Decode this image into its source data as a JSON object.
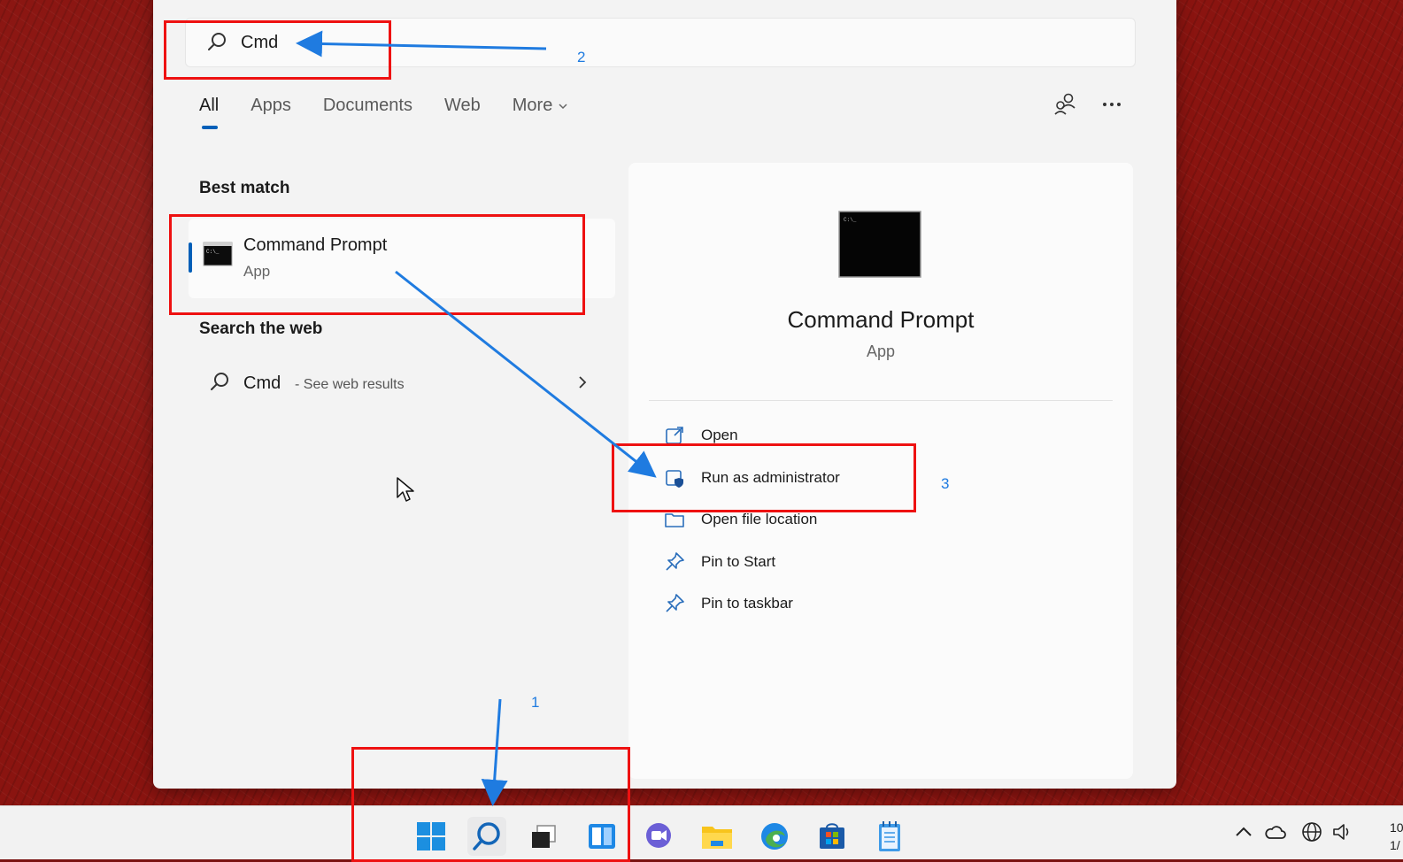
{
  "search": {
    "value": "Cmd",
    "placeholder": ""
  },
  "tabs": [
    {
      "label": "All",
      "active": true
    },
    {
      "label": "Apps"
    },
    {
      "label": "Documents"
    },
    {
      "label": "Web"
    },
    {
      "label": "More"
    }
  ],
  "best_match": {
    "heading": "Best match",
    "title": "Command Prompt",
    "subtitle": "App"
  },
  "web": {
    "heading": "Search the web",
    "query": "Cmd",
    "suffix": "- See web results"
  },
  "details": {
    "title": "Command Prompt",
    "subtitle": "App",
    "actions": [
      {
        "label": "Open",
        "icon": "open-external-icon"
      },
      {
        "label": "Run as administrator",
        "icon": "shield-window-icon"
      },
      {
        "label": "Open file location",
        "icon": "folder-icon"
      },
      {
        "label": "Pin to Start",
        "icon": "pin-icon"
      },
      {
        "label": "Pin to taskbar",
        "icon": "pin-icon"
      }
    ]
  },
  "annotations": {
    "step1": "1",
    "step2": "2",
    "step3": "3"
  },
  "clock": {
    "line1": "10",
    "line2": "1/"
  },
  "colors": {
    "accent": "#005fb8",
    "annotation_red": "#ee1111",
    "annotation_blue": "#1f7be0"
  }
}
